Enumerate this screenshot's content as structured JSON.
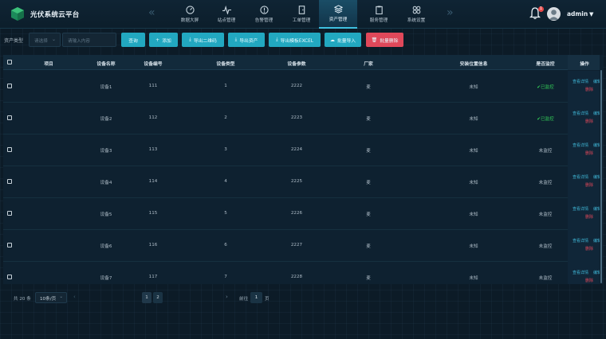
{
  "app": {
    "title": "光伏系统云平台"
  },
  "nav": {
    "items": [
      {
        "label": "数据大屏",
        "icon": "dashboard-gauge-icon"
      },
      {
        "label": "站点管理",
        "icon": "pulse-icon"
      },
      {
        "label": "告警管理",
        "icon": "alert-circle-icon"
      },
      {
        "label": "工单管理",
        "icon": "door-icon"
      },
      {
        "label": "资产管理",
        "icon": "layers-icon"
      },
      {
        "label": "服务管理",
        "icon": "clipboard-icon"
      },
      {
        "label": "系统设置",
        "icon": "grid-dots-icon"
      }
    ],
    "active_index": 4
  },
  "user": {
    "name": "admin",
    "notification_count": "1"
  },
  "filter": {
    "type_label": "资产类型",
    "select_placeholder": "请选择",
    "input_placeholder": "请输入内容"
  },
  "toolbar": {
    "query": "查询",
    "add": "添加",
    "export_qr": "导出二维码",
    "export_assets": "导出资产",
    "export_template": "导出模板EXCEL",
    "batch_import": "批量导入",
    "batch_delete": "批量删除"
  },
  "table": {
    "headers": {
      "project": "项目",
      "name": "设备名称",
      "code": "设备编号",
      "type": "设备类型",
      "params": "设备参数",
      "vendor": "厂家",
      "location": "安装位置信息",
      "monitor": "是否监控",
      "actions": "操作"
    },
    "rows": [
      {
        "project": "",
        "name": "设备1",
        "code": "111",
        "type": "1",
        "params": "2222",
        "vendor": "麦",
        "location": "未知",
        "monitor": "已监控",
        "monitored": true
      },
      {
        "project": "",
        "name": "设备2",
        "code": "112",
        "type": "2",
        "params": "2223",
        "vendor": "麦",
        "location": "未知",
        "monitor": "已监控",
        "monitored": true
      },
      {
        "project": "",
        "name": "设备3",
        "code": "113",
        "type": "3",
        "params": "2224",
        "vendor": "麦",
        "location": "未知",
        "monitor": "未监控",
        "monitored": false
      },
      {
        "project": "",
        "name": "设备4",
        "code": "114",
        "type": "4",
        "params": "2225",
        "vendor": "麦",
        "location": "未知",
        "monitor": "未监控",
        "monitored": false
      },
      {
        "project": "",
        "name": "设备5",
        "code": "115",
        "type": "5",
        "params": "2226",
        "vendor": "麦",
        "location": "未知",
        "monitor": "未监控",
        "monitored": false
      },
      {
        "project": "",
        "name": "设备6",
        "code": "116",
        "type": "6",
        "params": "2227",
        "vendor": "麦",
        "location": "未知",
        "monitor": "未监控",
        "monitored": false
      },
      {
        "project": "",
        "name": "设备7",
        "code": "117",
        "type": "7",
        "params": "2228",
        "vendor": "麦",
        "location": "未知",
        "monitor": "未监控",
        "monitored": false
      }
    ],
    "actions": {
      "view": "查看详情",
      "edit": "编辑",
      "delete": "删除"
    }
  },
  "pagination": {
    "total": "共 20 条",
    "page_size": "10条/页",
    "pages": [
      "1",
      "2"
    ],
    "current_page": "1",
    "goto_label": "前往",
    "goto_value": "1",
    "goto_suffix": "页"
  },
  "colors": {
    "accent": "#22a8c0",
    "danger": "#e0485a",
    "monitored": "#34d058"
  }
}
